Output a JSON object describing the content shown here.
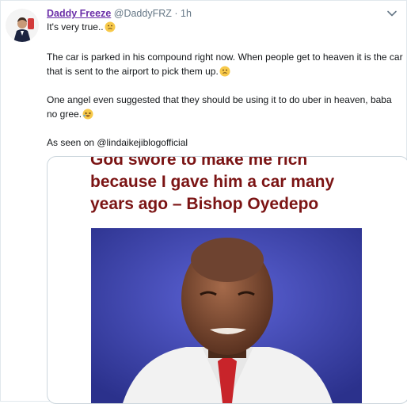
{
  "tweet": {
    "display_name": "Daddy Freeze",
    "handle": "@DaddyFRZ",
    "separator": "·",
    "time": "1h",
    "line1": "It's very true..",
    "para1": "The car is parked in his compound right now. When people get to heaven it is the car that is sent to the airport to pick them up.",
    "para2": "One angel even suggested that they should be using it to do uber in heaven, baba no gree.",
    "para3": "As seen on @lindaikejiblogofficial"
  },
  "card": {
    "headline_line1": "God swore to make me rich",
    "headline_line2": "because I gave him a car many",
    "headline_line3": "years ago – Bishop Oyedepo"
  },
  "icons": {
    "menu": "chevron-down-icon",
    "avatar": "avatar",
    "emoji1": "thinking-face-emoji",
    "emoji2": "thinking-face-emoji",
    "emoji3": "rolling-laughing-emoji"
  },
  "colors": {
    "name": "#6b2fa8",
    "headline": "#7b1414",
    "photo_bg": "#3f47b8"
  }
}
